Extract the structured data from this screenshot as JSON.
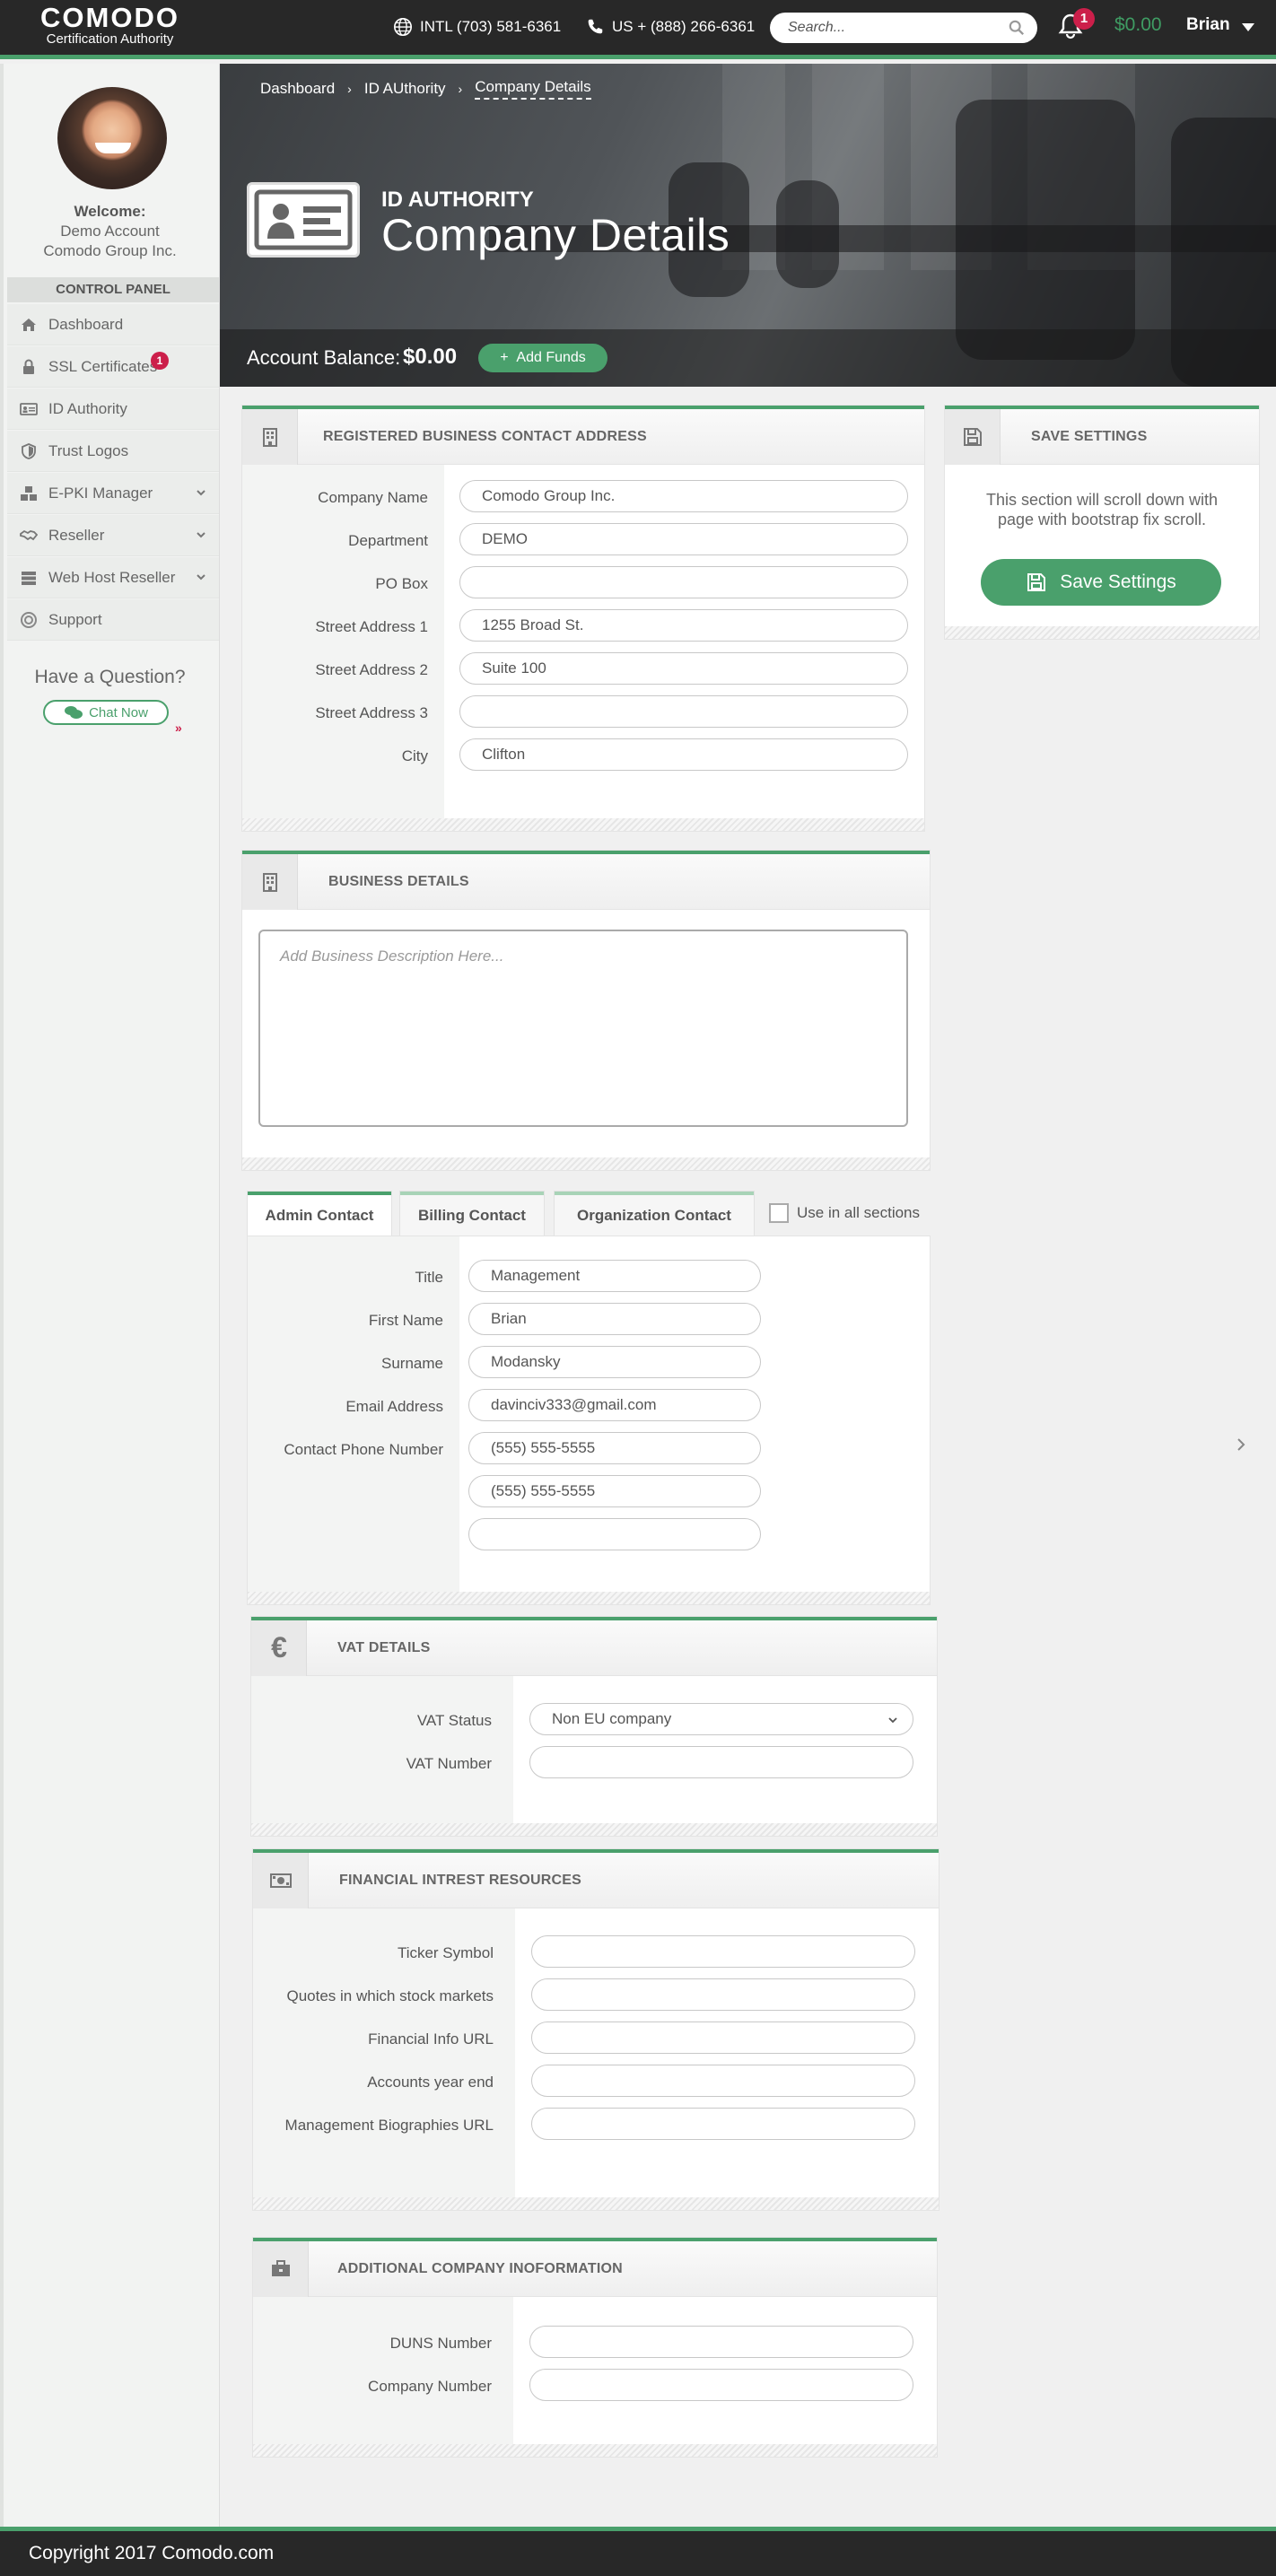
{
  "header": {
    "logo_main": "COMODO",
    "logo_sub": "Certification Authority",
    "intl_phone": "INTL (703) 581-6361",
    "us_phone": "US + (888) 266-6361",
    "search_placeholder": "Search...",
    "notification_count": "1",
    "balance": "$0.00",
    "user": "Brian"
  },
  "sidebar": {
    "welcome": "Welcome:",
    "account_line1": "Demo Account",
    "account_line2": "Comodo Group Inc.",
    "control_panel": "CONTROL PANEL",
    "items": [
      {
        "label": "Dashboard",
        "icon": "home-icon"
      },
      {
        "label": "SSL Certificates",
        "icon": "lock-icon",
        "badge": "1"
      },
      {
        "label": "ID Authority",
        "icon": "id-card-icon"
      },
      {
        "label": "Trust Logos",
        "icon": "shield-icon"
      },
      {
        "label": "E-PKI Manager",
        "icon": "cubes-icon"
      },
      {
        "label": "Reseller",
        "icon": "handshake-icon"
      },
      {
        "label": "Web Host Reseller",
        "icon": "server-icon"
      },
      {
        "label": "Support",
        "icon": "lifebuoy-icon"
      }
    ],
    "question": "Have a Question?",
    "chat": "Chat Now"
  },
  "hero": {
    "breadcrumb": [
      "Dashboard",
      "ID AUthority",
      "Company Details"
    ],
    "subtitle": "ID AUTHORITY",
    "title": "Company Details",
    "balance_label": "Account Balance:",
    "balance_value": "$0.00",
    "add_funds": "Add Funds"
  },
  "address": {
    "title": "REGISTERED BUSINESS CONTACT ADDRESS",
    "fields": [
      {
        "label": "Company Name",
        "value": "Comodo Group Inc."
      },
      {
        "label": "Department",
        "value": "DEMO"
      },
      {
        "label": "PO Box",
        "value": ""
      },
      {
        "label": "Street Address 1",
        "value": "1255 Broad St."
      },
      {
        "label": "Street Address 2",
        "value": "Suite 100"
      },
      {
        "label": "Street Address 3",
        "value": ""
      },
      {
        "label": "City",
        "value": "Clifton"
      }
    ]
  },
  "save": {
    "title": "SAVE SETTINGS",
    "text": "This section will scroll down with page with bootstrap fix scroll.",
    "button": "Save Settings"
  },
  "business": {
    "title": "BUSINESS DETAILS",
    "placeholder": "Add Business Description Here..."
  },
  "contacts": {
    "tabs": [
      "Admin Contact",
      "Billing Contact",
      "Organization Contact"
    ],
    "use_all": "Use in all sections",
    "fields": [
      {
        "label": "Title",
        "value": "Management"
      },
      {
        "label": "First Name",
        "value": "Brian"
      },
      {
        "label": "Surname",
        "value": "Modansky"
      },
      {
        "label": "Email Address",
        "value": "davinciv333@gmail.com"
      },
      {
        "label": "Contact Phone Number",
        "value": "(555) 555-5555"
      },
      {
        "label": "",
        "value": "(555) 555-5555"
      },
      {
        "label": "",
        "value": ""
      }
    ]
  },
  "vat": {
    "title": "VAT DETAILS",
    "status_label": "VAT Status",
    "status_value": "Non EU company",
    "number_label": "VAT Number",
    "number_value": ""
  },
  "financial": {
    "title": "FINANCIAL INTREST RESOURCES",
    "fields": [
      {
        "label": "Ticker Symbol",
        "value": ""
      },
      {
        "label": "Quotes in which stock markets",
        "value": ""
      },
      {
        "label": "Financial Info URL",
        "value": ""
      },
      {
        "label": "Accounts year end",
        "value": ""
      },
      {
        "label": "Management Biographies URL",
        "value": ""
      }
    ]
  },
  "additional": {
    "title": "ADDITIONAL COMPANY INOFORMATION",
    "fields": [
      {
        "label": "DUNS Number",
        "value": ""
      },
      {
        "label": "Company Number",
        "value": ""
      }
    ]
  },
  "footer": {
    "copyright": "Copyright 2017 Comodo.com"
  },
  "colors": {
    "accent": "#4aa06c",
    "badge": "#cc1f4a",
    "topbar": "#282828"
  }
}
